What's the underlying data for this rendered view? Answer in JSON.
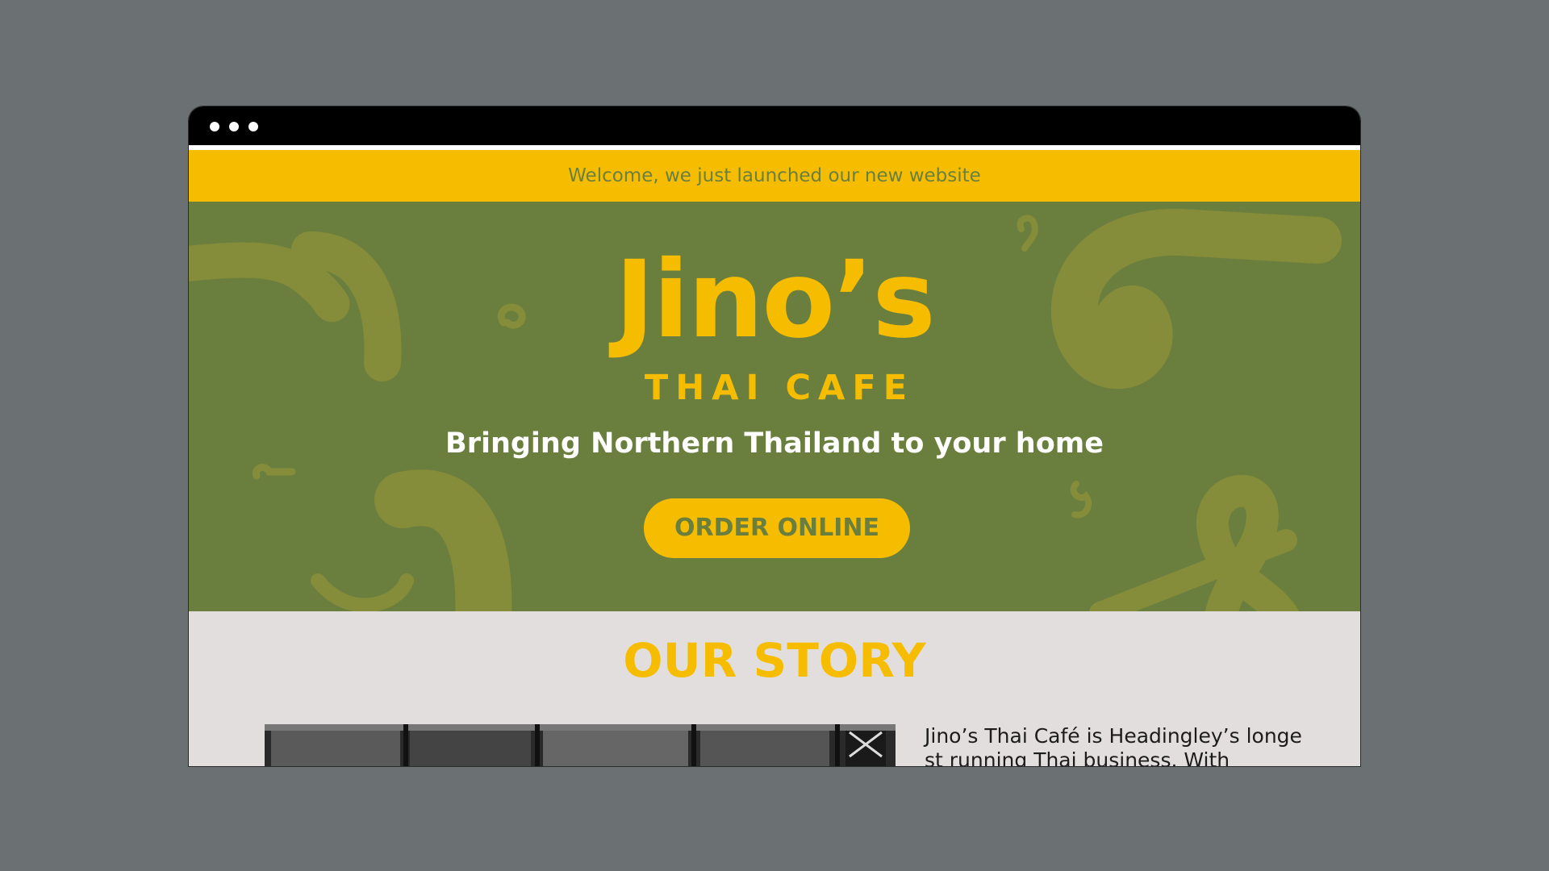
{
  "window": {
    "controls": [
      "window-dot",
      "window-dot",
      "window-dot"
    ]
  },
  "announcement": {
    "text": "Welcome, we just launched our new website"
  },
  "hero": {
    "logo_name": "Jino’s",
    "logo_subtitle": "THAI CAFE",
    "tagline": "Bringing Northern Thailand to your home",
    "cta_label": "ORDER ONLINE"
  },
  "story": {
    "title": "OUR STORY",
    "body": "Jino’s Thai Café is Headingley’s longest running Thai business. With"
  },
  "colors": {
    "background": "#6b7073",
    "accent_yellow": "#f6bd00",
    "hero_green": "#6a7f3e",
    "story_bg": "#e2dede"
  }
}
